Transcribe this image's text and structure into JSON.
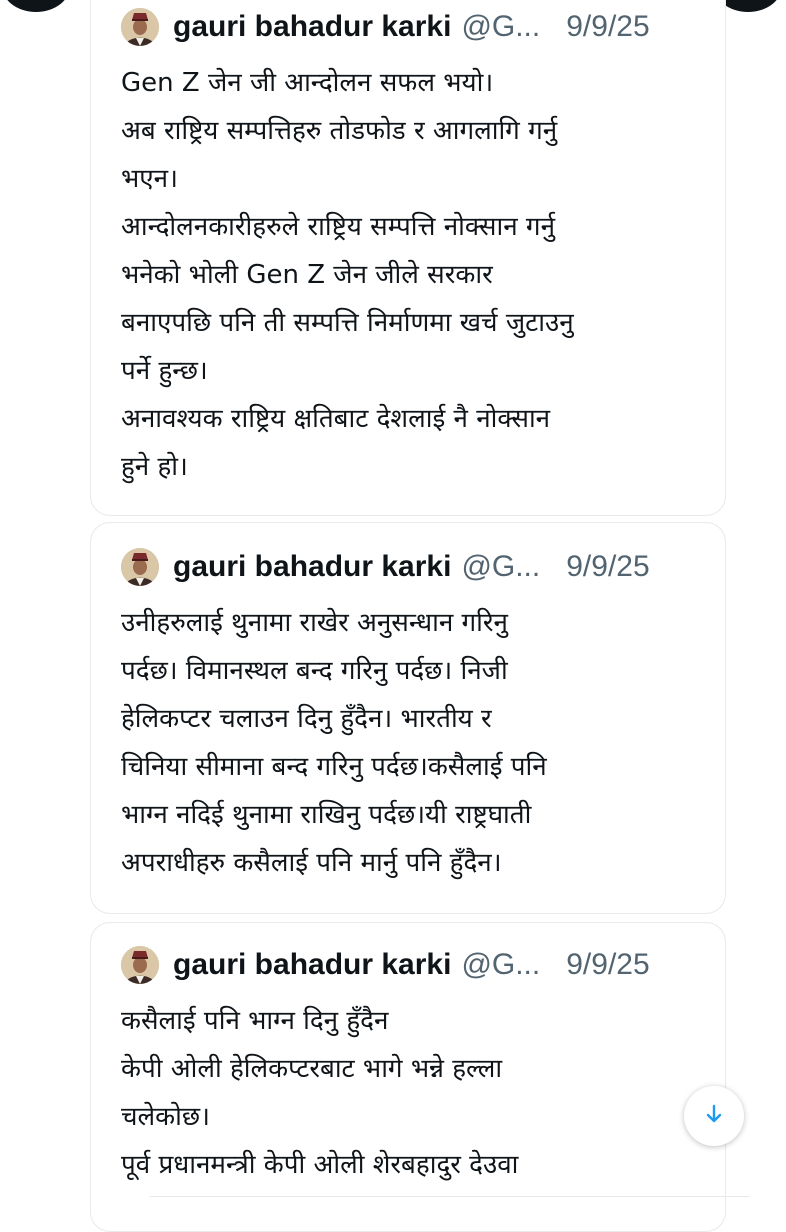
{
  "colors": {
    "text_primary": "#0f1419",
    "text_secondary": "#536471",
    "border": "#e7e9ea",
    "accent": "#1d9bf0"
  },
  "tweets": [
    {
      "display_name": "gauri bahadur karki",
      "handle": "@G...",
      "date": "9/9/25",
      "lines": [
        "Gen Z जेन जी आन्दोलन सफल भयो।",
        "अब राष्ट्रिय सम्पत्तिहरु तोडफोड र आगलागि गर्नु",
        "भएन।",
        "आन्दोलनकारीहरुले राष्ट्रिय सम्पत्ति नोक्सान गर्नु",
        "भनेको भोली Gen Z जेन जीले सरकार",
        "बनाएपछि पनि ती सम्पत्ति निर्माणमा खर्च जुटाउनु",
        "पर्ने हुन्छ।",
        "अनावश्यक राष्ट्रिय क्षतिबाट देशलाई नै नोक्सान",
        "हुने हो।"
      ]
    },
    {
      "display_name": "gauri bahadur karki",
      "handle": "@G...",
      "date": "9/9/25",
      "lines": [
        "उनीहरुलाई थुनामा राखेर अनुसन्धान गरिनु",
        "पर्दछ। विमानस्थल बन्द गरिनु पर्दछ। निजी",
        "हेलिकप्टर चलाउन दिनु हुँदैन। भारतीय र",
        "चिनिया सीमाना बन्द गरिनु पर्दछ।कसैलाई पनि",
        "भाग्न नदिई थुनामा राखिनु पर्दछ।यी राष्ट्रघाती",
        "अपराधीहरु कसैलाई पनि मार्नु पनि हुँदैन।"
      ]
    },
    {
      "display_name": "gauri bahadur karki",
      "handle": "@G...",
      "date": "9/9/25",
      "lines": [
        "कसैलाई पनि भाग्न दिनु हुँदैन",
        "केपी ओली हेलिकप्टरबाट भागे भन्ने हल्ला",
        "चलेकोछ।",
        "पूर्व प्रधानमन्त्री केपी ओली शेरबहादुर देउवा"
      ]
    }
  ],
  "scroll_button": {
    "icon": "arrow-down-icon"
  }
}
